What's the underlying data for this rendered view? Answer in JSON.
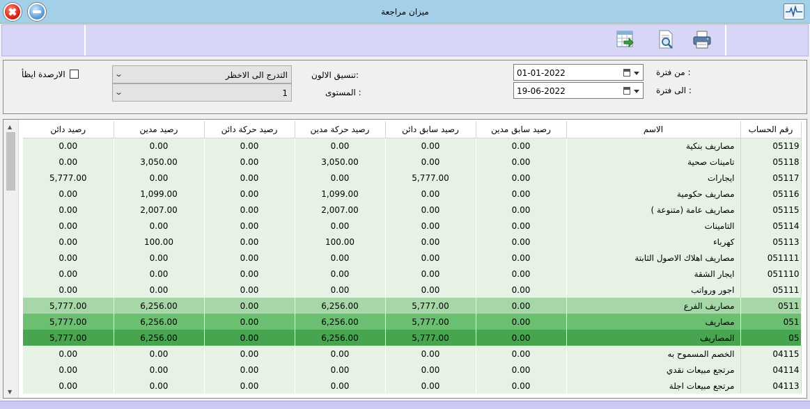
{
  "window": {
    "title": "ميزان مراجعة",
    "icons": {
      "close": "close-icon",
      "minimize": "minimize-icon",
      "app": "pulse-monitor-icon"
    }
  },
  "toolbar": {
    "buttons": [
      {
        "name": "export-excel-button",
        "icon": "spreadsheet-export-icon"
      },
      {
        "name": "print-preview-button",
        "icon": "print-preview-icon"
      },
      {
        "name": "print-button",
        "icon": "printer-icon"
      }
    ]
  },
  "filters": {
    "from_label": "من فترة :",
    "from_date": "01-01-2022",
    "to_label": "الى فترة :",
    "to_date": "19-06-2022",
    "color_label": "تنسيق الالون:",
    "color_value": "التدرج الى الاخظر",
    "level_label": "المستوى :",
    "level_value": "1",
    "zero_balances_label": "الارصدة ايظأ",
    "zero_balances_checked": false
  },
  "grid": {
    "columns": [
      "رقم الحساب",
      "الاسم",
      "رصيد سابق مدين",
      "رصيد سابق دائن",
      "رصيد حركة مدين",
      "رصيد حركة دائن",
      "رصيد مدين",
      "رصيد دائن"
    ],
    "rows": [
      {
        "acc": "05119",
        "name": "مصاريف بنكية",
        "c1": "0.00",
        "c2": "0.00",
        "c3": "0.00",
        "c4": "0.00",
        "c5": "0.00",
        "c6": "0.00",
        "level": 0
      },
      {
        "acc": "05118",
        "name": "تامينات صحية",
        "c1": "0.00",
        "c2": "0.00",
        "c3": "3,050.00",
        "c4": "0.00",
        "c5": "3,050.00",
        "c6": "0.00",
        "level": 0
      },
      {
        "acc": "05117",
        "name": "ايجارات",
        "c1": "0.00",
        "c2": "5,777.00",
        "c3": "0.00",
        "c4": "0.00",
        "c5": "0.00",
        "c6": "5,777.00",
        "level": 0
      },
      {
        "acc": "05116",
        "name": "مصاريف حكومية",
        "c1": "0.00",
        "c2": "0.00",
        "c3": "1,099.00",
        "c4": "0.00",
        "c5": "1,099.00",
        "c6": "0.00",
        "level": 0
      },
      {
        "acc": "05115",
        "name": "مصاريف عامة (متنوعة )",
        "c1": "0.00",
        "c2": "0.00",
        "c3": "2,007.00",
        "c4": "0.00",
        "c5": "2,007.00",
        "c6": "0.00",
        "level": 0
      },
      {
        "acc": "05114",
        "name": "التامينات",
        "c1": "0.00",
        "c2": "0.00",
        "c3": "0.00",
        "c4": "0.00",
        "c5": "0.00",
        "c6": "0.00",
        "level": 0
      },
      {
        "acc": "05113",
        "name": "كهرباء",
        "c1": "0.00",
        "c2": "0.00",
        "c3": "100.00",
        "c4": "0.00",
        "c5": "100.00",
        "c6": "0.00",
        "level": 0
      },
      {
        "acc": "051111",
        "name": "مصاريف اهلاك الاصول الثابتة",
        "c1": "0.00",
        "c2": "0.00",
        "c3": "0.00",
        "c4": "0.00",
        "c5": "0.00",
        "c6": "0.00",
        "level": 0
      },
      {
        "acc": "051110",
        "name": "ايجار الشقة",
        "c1": "0.00",
        "c2": "0.00",
        "c3": "0.00",
        "c4": "0.00",
        "c5": "0.00",
        "c6": "0.00",
        "level": 0
      },
      {
        "acc": "05111",
        "name": "اجور ورواتب",
        "c1": "0.00",
        "c2": "0.00",
        "c3": "0.00",
        "c4": "0.00",
        "c5": "0.00",
        "c6": "0.00",
        "level": 0
      },
      {
        "acc": "0511",
        "name": "مصاريف الفرع",
        "c1": "0.00",
        "c2": "5,777.00",
        "c3": "6,256.00",
        "c4": "0.00",
        "c5": "6,256.00",
        "c6": "5,777.00",
        "level": 1
      },
      {
        "acc": "051",
        "name": "مصاريف",
        "c1": "0.00",
        "c2": "5,777.00",
        "c3": "6,256.00",
        "c4": "0.00",
        "c5": "6,256.00",
        "c6": "5,777.00",
        "level": 2
      },
      {
        "acc": "05",
        "name": "المصاريف",
        "c1": "0.00",
        "c2": "5,777.00",
        "c3": "6,256.00",
        "c4": "0.00",
        "c5": "6,256.00",
        "c6": "5,777.00",
        "level": 3
      },
      {
        "acc": "04115",
        "name": "الخصم المسموح به",
        "c1": "0.00",
        "c2": "0.00",
        "c3": "0.00",
        "c4": "0.00",
        "c5": "0.00",
        "c6": "0.00",
        "level": 0
      },
      {
        "acc": "04114",
        "name": "مرتجع مبيعات نقدي",
        "c1": "0.00",
        "c2": "0.00",
        "c3": "0.00",
        "c4": "0.00",
        "c5": "0.00",
        "c6": "0.00",
        "level": 0
      },
      {
        "acc": "04113",
        "name": "مرتجع مبيعات اجلة",
        "c1": "0.00",
        "c2": "0.00",
        "c3": "0.00",
        "c4": "0.00",
        "c5": "0.00",
        "c6": "0.00",
        "level": 0
      }
    ]
  }
}
